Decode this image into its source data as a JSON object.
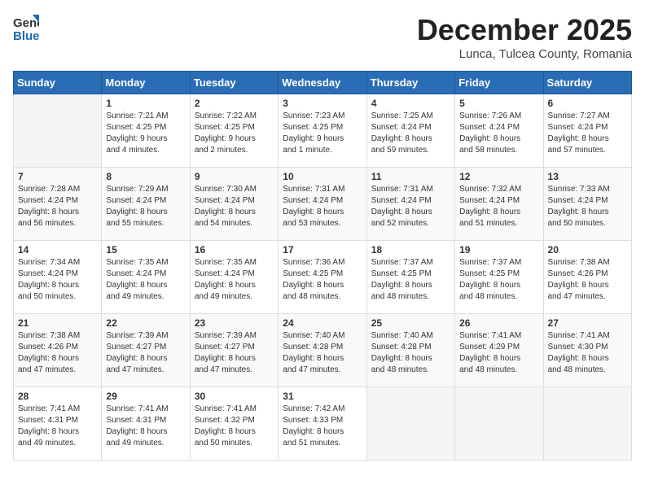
{
  "logo": {
    "line1": "General",
    "line2": "Blue"
  },
  "title": "December 2025",
  "subtitle": "Lunca, Tulcea County, Romania",
  "days_of_week": [
    "Sunday",
    "Monday",
    "Tuesday",
    "Wednesday",
    "Thursday",
    "Friday",
    "Saturday"
  ],
  "weeks": [
    [
      {
        "day": "",
        "info": ""
      },
      {
        "day": "1",
        "info": "Sunrise: 7:21 AM\nSunset: 4:25 PM\nDaylight: 9 hours\nand 4 minutes."
      },
      {
        "day": "2",
        "info": "Sunrise: 7:22 AM\nSunset: 4:25 PM\nDaylight: 9 hours\nand 2 minutes."
      },
      {
        "day": "3",
        "info": "Sunrise: 7:23 AM\nSunset: 4:25 PM\nDaylight: 9 hours\nand 1 minute."
      },
      {
        "day": "4",
        "info": "Sunrise: 7:25 AM\nSunset: 4:24 PM\nDaylight: 8 hours\nand 59 minutes."
      },
      {
        "day": "5",
        "info": "Sunrise: 7:26 AM\nSunset: 4:24 PM\nDaylight: 8 hours\nand 58 minutes."
      },
      {
        "day": "6",
        "info": "Sunrise: 7:27 AM\nSunset: 4:24 PM\nDaylight: 8 hours\nand 57 minutes."
      }
    ],
    [
      {
        "day": "7",
        "info": "Sunrise: 7:28 AM\nSunset: 4:24 PM\nDaylight: 8 hours\nand 56 minutes."
      },
      {
        "day": "8",
        "info": "Sunrise: 7:29 AM\nSunset: 4:24 PM\nDaylight: 8 hours\nand 55 minutes."
      },
      {
        "day": "9",
        "info": "Sunrise: 7:30 AM\nSunset: 4:24 PM\nDaylight: 8 hours\nand 54 minutes."
      },
      {
        "day": "10",
        "info": "Sunrise: 7:31 AM\nSunset: 4:24 PM\nDaylight: 8 hours\nand 53 minutes."
      },
      {
        "day": "11",
        "info": "Sunrise: 7:31 AM\nSunset: 4:24 PM\nDaylight: 8 hours\nand 52 minutes."
      },
      {
        "day": "12",
        "info": "Sunrise: 7:32 AM\nSunset: 4:24 PM\nDaylight: 8 hours\nand 51 minutes."
      },
      {
        "day": "13",
        "info": "Sunrise: 7:33 AM\nSunset: 4:24 PM\nDaylight: 8 hours\nand 50 minutes."
      }
    ],
    [
      {
        "day": "14",
        "info": "Sunrise: 7:34 AM\nSunset: 4:24 PM\nDaylight: 8 hours\nand 50 minutes."
      },
      {
        "day": "15",
        "info": "Sunrise: 7:35 AM\nSunset: 4:24 PM\nDaylight: 8 hours\nand 49 minutes."
      },
      {
        "day": "16",
        "info": "Sunrise: 7:35 AM\nSunset: 4:24 PM\nDaylight: 8 hours\nand 49 minutes."
      },
      {
        "day": "17",
        "info": "Sunrise: 7:36 AM\nSunset: 4:25 PM\nDaylight: 8 hours\nand 48 minutes."
      },
      {
        "day": "18",
        "info": "Sunrise: 7:37 AM\nSunset: 4:25 PM\nDaylight: 8 hours\nand 48 minutes."
      },
      {
        "day": "19",
        "info": "Sunrise: 7:37 AM\nSunset: 4:25 PM\nDaylight: 8 hours\nand 48 minutes."
      },
      {
        "day": "20",
        "info": "Sunrise: 7:38 AM\nSunset: 4:26 PM\nDaylight: 8 hours\nand 47 minutes."
      }
    ],
    [
      {
        "day": "21",
        "info": "Sunrise: 7:38 AM\nSunset: 4:26 PM\nDaylight: 8 hours\nand 47 minutes."
      },
      {
        "day": "22",
        "info": "Sunrise: 7:39 AM\nSunset: 4:27 PM\nDaylight: 8 hours\nand 47 minutes."
      },
      {
        "day": "23",
        "info": "Sunrise: 7:39 AM\nSunset: 4:27 PM\nDaylight: 8 hours\nand 47 minutes."
      },
      {
        "day": "24",
        "info": "Sunrise: 7:40 AM\nSunset: 4:28 PM\nDaylight: 8 hours\nand 47 minutes."
      },
      {
        "day": "25",
        "info": "Sunrise: 7:40 AM\nSunset: 4:28 PM\nDaylight: 8 hours\nand 48 minutes."
      },
      {
        "day": "26",
        "info": "Sunrise: 7:41 AM\nSunset: 4:29 PM\nDaylight: 8 hours\nand 48 minutes."
      },
      {
        "day": "27",
        "info": "Sunrise: 7:41 AM\nSunset: 4:30 PM\nDaylight: 8 hours\nand 48 minutes."
      }
    ],
    [
      {
        "day": "28",
        "info": "Sunrise: 7:41 AM\nSunset: 4:31 PM\nDaylight: 8 hours\nand 49 minutes."
      },
      {
        "day": "29",
        "info": "Sunrise: 7:41 AM\nSunset: 4:31 PM\nDaylight: 8 hours\nand 49 minutes."
      },
      {
        "day": "30",
        "info": "Sunrise: 7:41 AM\nSunset: 4:32 PM\nDaylight: 8 hours\nand 50 minutes."
      },
      {
        "day": "31",
        "info": "Sunrise: 7:42 AM\nSunset: 4:33 PM\nDaylight: 8 hours\nand 51 minutes."
      },
      {
        "day": "",
        "info": ""
      },
      {
        "day": "",
        "info": ""
      },
      {
        "day": "",
        "info": ""
      }
    ]
  ]
}
